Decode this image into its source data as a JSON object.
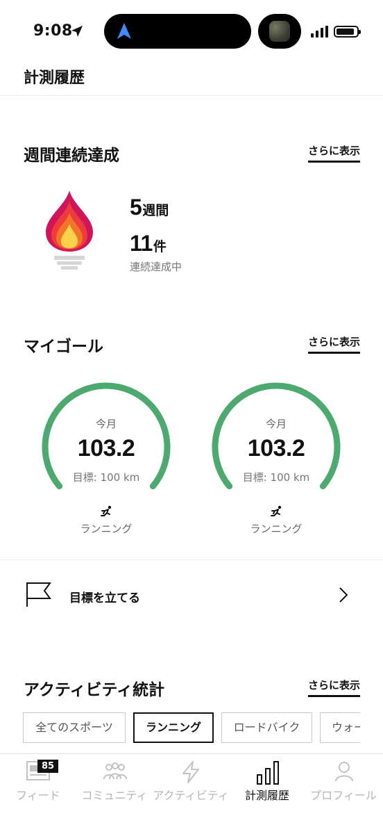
{
  "status_bar": {
    "time": "9:08"
  },
  "page_title": "計測履歴",
  "streak": {
    "title": "週間連続達成",
    "more": "さらに表示",
    "weeks_value": "5",
    "weeks_unit": "週間",
    "count_value": "11",
    "count_unit": "件",
    "status": "連続達成中"
  },
  "goals": {
    "title": "マイゴール",
    "more": "さらに表示",
    "items": [
      {
        "period": "今月",
        "value": "103.2",
        "target": "目標: 100 km",
        "sport": "ランニング",
        "progress": 1.0
      },
      {
        "period": "今月",
        "value": "103.2",
        "target": "目標: 100 km",
        "sport": "ランニング",
        "progress": 1.0
      }
    ],
    "set_goal": "目標を立てる"
  },
  "stats": {
    "title": "アクティビティ統計",
    "more": "さらに表示",
    "filters": [
      "全てのスポーツ",
      "ランニング",
      "ロードバイク",
      "ウォー"
    ],
    "active_filter": "ランニング"
  },
  "tabbar": {
    "items": [
      {
        "label": "フィード",
        "icon": "feed-icon",
        "badge": "85"
      },
      {
        "label": "コミュニティ",
        "icon": "community-icon"
      },
      {
        "label": "アクティビティ",
        "icon": "activity-icon"
      },
      {
        "label": "計測履歴",
        "icon": "stats-icon"
      },
      {
        "label": "プロフィール",
        "icon": "profile-icon"
      }
    ],
    "active": "計測履歴"
  },
  "colors": {
    "goal_ring": "#4caa6e",
    "flame_outer": "#d0155a",
    "flame_mid": "#f2592a",
    "flame_inner": "#fbd34a"
  }
}
